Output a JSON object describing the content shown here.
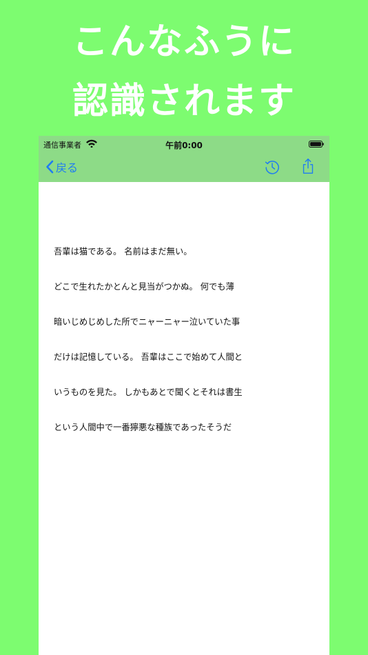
{
  "headline": {
    "line1": "こんなふうに",
    "line2": "認識されます"
  },
  "status_bar": {
    "carrier": "通信事業者",
    "time": "午前0:00",
    "icons": [
      "wifi-icon",
      "battery-icon"
    ]
  },
  "nav_bar": {
    "back_label": "戻る",
    "icons": [
      "chevron-left-icon",
      "history-icon",
      "share-icon"
    ],
    "accent_color": "#1f7cf2",
    "background_color": "#8ddb87"
  },
  "recognized_text": {
    "lines": [
      "吾輩は猫である。 名前はまだ無い。",
      "どこで生れたかとんと見当がつかぬ。 何でも薄",
      "暗いじめじめした所でニャーニャー泣いていた事",
      "だけは記憶している。 吾輩はここで始めて人間と",
      "いうものを見た。 しかもあとで聞くとそれは書生",
      "という人間中で一番獰悪な種族であったそうだ"
    ]
  },
  "colors": {
    "page_background": "#7dfc70",
    "headline": "#ffffff"
  }
}
